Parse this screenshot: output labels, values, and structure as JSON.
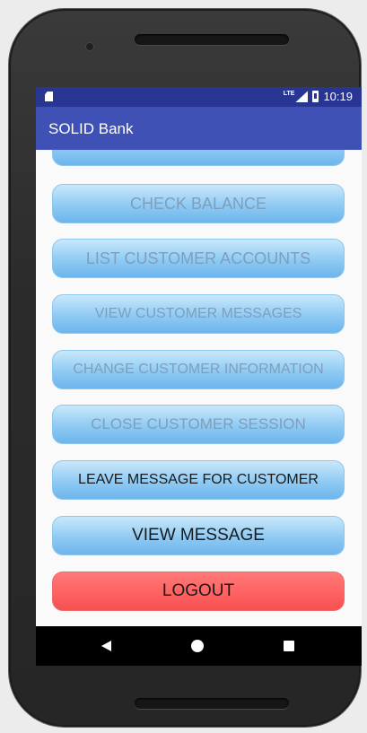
{
  "status_bar": {
    "network": "LTE",
    "time": "10:19"
  },
  "app_bar": {
    "title": "SOLID Bank"
  },
  "buttons": [
    {
      "label": "",
      "enabled": false
    },
    {
      "label": "CHECK BALANCE",
      "enabled": false
    },
    {
      "label": "LIST CUSTOMER ACCOUNTS",
      "enabled": false
    },
    {
      "label": "VIEW CUSTOMER MESSAGES",
      "enabled": false
    },
    {
      "label": "CHANGE CUSTOMER INFORMATION",
      "enabled": false
    },
    {
      "label": "CLOSE CUSTOMER SESSION",
      "enabled": false
    },
    {
      "label": "LEAVE MESSAGE FOR CUSTOMER",
      "enabled": true
    },
    {
      "label": "VIEW MESSAGE",
      "enabled": true
    },
    {
      "label": "LOGOUT",
      "enabled": true
    }
  ],
  "colors": {
    "status_bar": "#283593",
    "app_bar": "#3f51b5",
    "button_blue": "#8fcaf3",
    "logout_red": "#ff5f5f"
  },
  "icons": {
    "status_left": "sim-card-icon",
    "signal": "signal-icon",
    "battery": "battery-icon",
    "nav_back": "back-triangle-icon",
    "nav_home": "home-circle-icon",
    "nav_recent": "recent-apps-square-icon"
  }
}
